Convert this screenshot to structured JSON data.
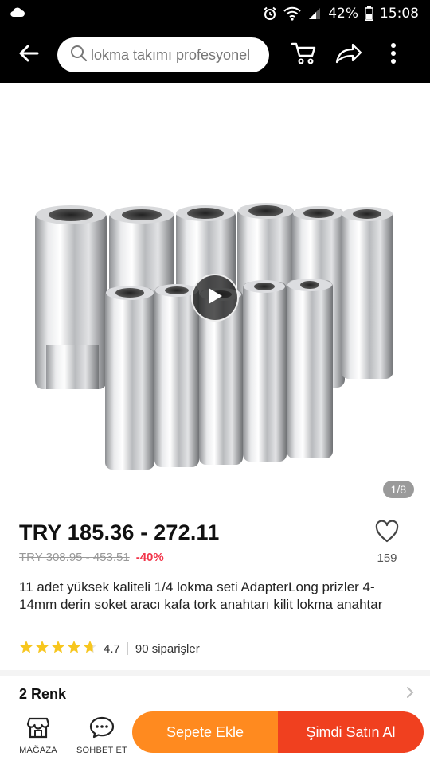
{
  "status_bar": {
    "battery": "42%",
    "time": "15:08"
  },
  "search": {
    "placeholder": "lokma takımı profesyonel"
  },
  "gallery": {
    "page_indicator": "1/8"
  },
  "product": {
    "price_range": "TRY 185.36 - 272.11",
    "original_price": "TRY 308.95 - 453.51",
    "discount": "-40%",
    "wishlist_count": "159",
    "title": "11 adet yüksek kaliteli 1/4 lokma seti AdapterLong prizler 4-14mm derin soket aracı kafa tork anahtarı kilit lokma anahtar",
    "rating": "4.7",
    "rating_stars": 4.7,
    "orders": "90 siparişler",
    "color_option": "2 Renk"
  },
  "bottom_bar": {
    "store_label": "MAĞAZA",
    "chat_label": "SOHBET ET",
    "add_to_cart_label": "Sepete Ekle",
    "buy_now_label": "Şimdi Satın Al"
  },
  "colors": {
    "add_to_cart": "#ff8a1f",
    "buy_now": "#f0401f",
    "discount": "#f2354a",
    "star": "#f7c61e"
  }
}
